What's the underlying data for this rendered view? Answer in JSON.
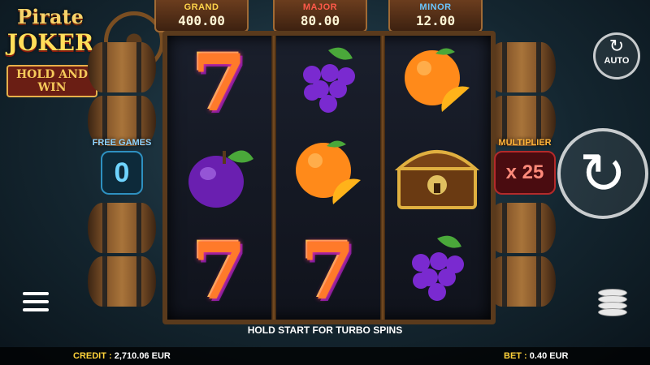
{
  "logo": {
    "line1": "Pirate",
    "line2": "JOKER",
    "line3": "HOLD AND WIN"
  },
  "jackpots": [
    {
      "label": "GRAND",
      "value": "400.00"
    },
    {
      "label": "MAJOR",
      "value": "80.00"
    },
    {
      "label": "MINOR",
      "value": "12.00"
    }
  ],
  "reels": [
    [
      "seven",
      "plum",
      "seven"
    ],
    [
      "grapes",
      "orange",
      "seven"
    ],
    [
      "orange",
      "treasure-chest",
      "grapes"
    ]
  ],
  "free_games": {
    "label": "FREE GAMES",
    "value": "0"
  },
  "multiplier": {
    "label": "MULTIPLIER",
    "value": "x 25"
  },
  "auto": {
    "label": "AUTO"
  },
  "hint": "HOLD START FOR TURBO SPINS",
  "footer": {
    "credit_label": "CREDIT :",
    "credit_value": "2,710.06 EUR",
    "bet_label": "BET :",
    "bet_value": "0.40 EUR"
  },
  "symbol_text": {
    "seven": "7"
  }
}
